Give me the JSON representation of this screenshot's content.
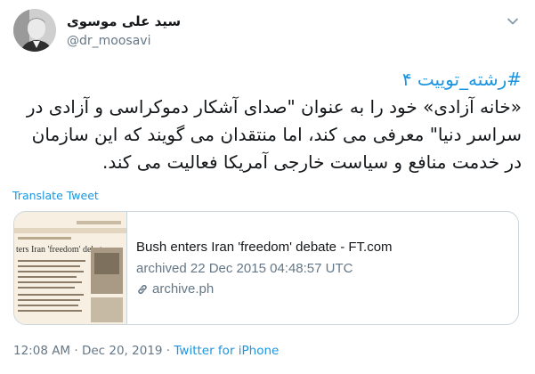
{
  "author": {
    "display_name": "سید علی موسوی",
    "handle": "@dr_moosavi"
  },
  "tweet": {
    "hashtag": "#رشته_توییت ۴",
    "text": "«خانه آزادی» خود را به عنوان \"صدای آشکار دموکراسی و آزادی در سراسر دنیا\" معرفی می کند، اما منتقدان می گویند که این سازمان در خدمت منافع و سیاست خارجی آمریکا فعالیت می کند.",
    "translate_label": "Translate Tweet"
  },
  "card": {
    "title": "Bush enters Iran 'freedom' debate - FT.com",
    "description": "archived 22 Dec 2015 04:48:57 UTC",
    "domain": "archive.ph",
    "thumb_headline": "ters Iran 'freedom' debate"
  },
  "footer": {
    "time": "12:08 AM",
    "separator1": " · ",
    "date": "Dec 20, 2019",
    "separator2": " · ",
    "source": "Twitter for iPhone"
  },
  "colors": {
    "link": "#1b95e0",
    "secondary": "#657786",
    "border": "#ccd6dd"
  }
}
